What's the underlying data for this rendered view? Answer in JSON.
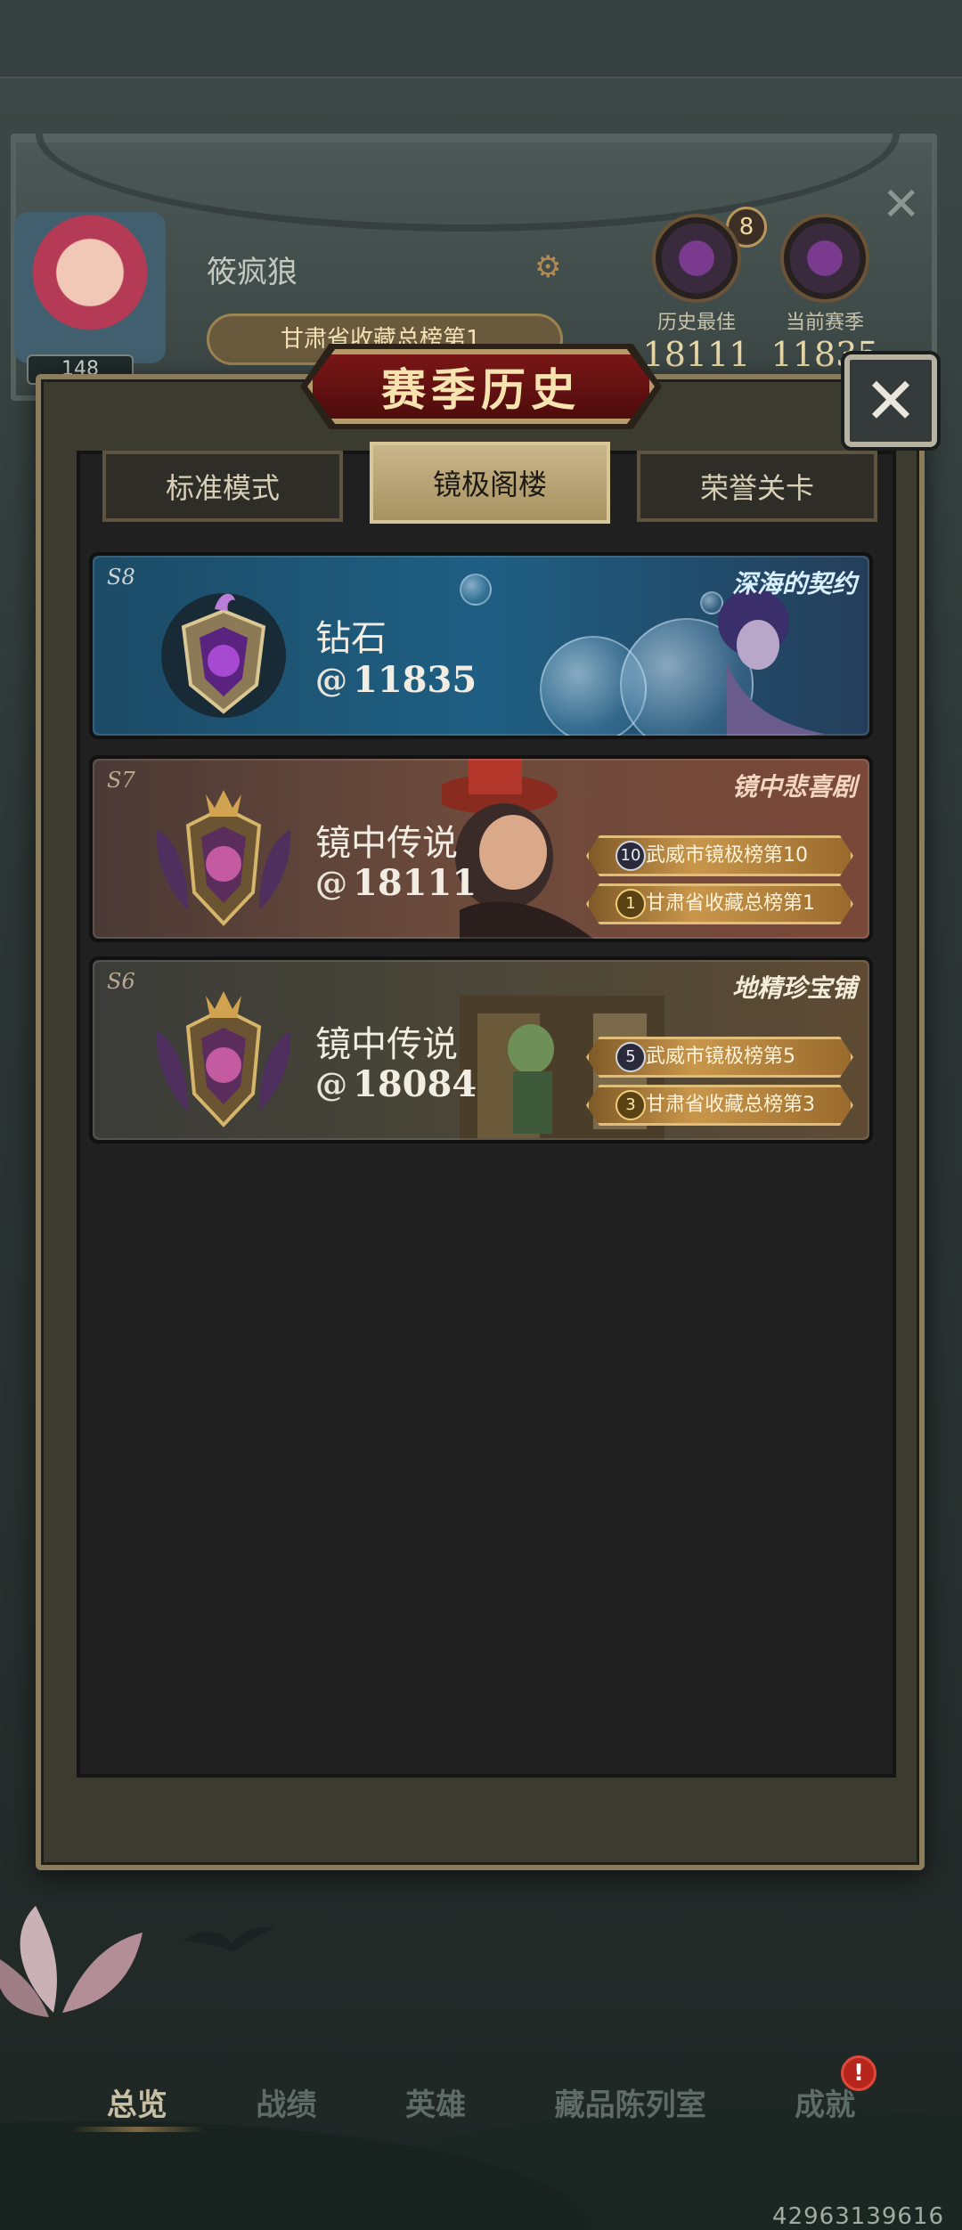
{
  "background": {
    "player_name": "筱疯狼",
    "level": "148",
    "rank_pill": "甘肃省收藏总榜第1",
    "stats": [
      {
        "label": "历史最佳",
        "value": "18111"
      },
      {
        "label": "当前赛季",
        "value": "11835"
      }
    ],
    "season_badge": "8"
  },
  "modal": {
    "title": "赛季历史",
    "close_glyph": "✕",
    "tabs": [
      {
        "label": "标准模式",
        "active": false
      },
      {
        "label": "镜极阁楼",
        "active": true
      },
      {
        "label": "荣誉关卡",
        "active": false
      }
    ]
  },
  "seasons": [
    {
      "season": "S8",
      "rank": "钻石",
      "score": "11835",
      "theme_title": "深海的契约",
      "honors": []
    },
    {
      "season": "S7",
      "rank": "镜中传说",
      "score": "18111",
      "theme_title": "镜中悲喜剧",
      "honors": [
        {
          "num": "10",
          "text": "武威市镜极榜第10"
        },
        {
          "num": "1",
          "text": "甘肃省收藏总榜第1"
        }
      ]
    },
    {
      "season": "S6",
      "rank": "镜中传说",
      "score": "18084",
      "theme_title": "地精珍宝铺",
      "honors": [
        {
          "num": "5",
          "text": "武威市镜极榜第5"
        },
        {
          "num": "3",
          "text": "甘肃省收藏总榜第3"
        }
      ]
    }
  ],
  "bottom_nav": [
    {
      "label": "总览",
      "active": true
    },
    {
      "label": "战绩",
      "active": false
    },
    {
      "label": "英雄",
      "active": false
    },
    {
      "label": "藏品陈列室",
      "active": false
    },
    {
      "label": "成就",
      "active": false
    }
  ],
  "alert_badge": "!",
  "uid": "42963139616",
  "icons": {
    "score": "spiral-icon",
    "close": "close-icon",
    "settings": "gear-icon"
  }
}
